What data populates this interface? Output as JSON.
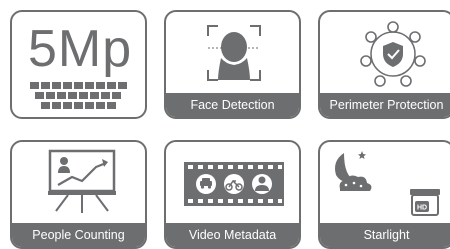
{
  "features": {
    "resolution": {
      "label": "5Mp",
      "icon": "pixel-grid-icon"
    },
    "face_detection": {
      "label": "Face Detection",
      "icon": "face-detection-icon"
    },
    "perimeter_protection": {
      "label": "Perimeter Protection",
      "icon": "perimeter-shield-icon"
    },
    "people_counting": {
      "label": "People Counting",
      "icon": "people-counting-chart-icon"
    },
    "video_metadata": {
      "label": "Video Metadata",
      "icon": "film-strip-metadata-icon"
    },
    "starlight": {
      "label": "Starlight",
      "icon": "night-camera-icon",
      "badge": "HD"
    }
  },
  "colors": {
    "tile": "#6d6e70",
    "caption_text": "#ffffff"
  }
}
